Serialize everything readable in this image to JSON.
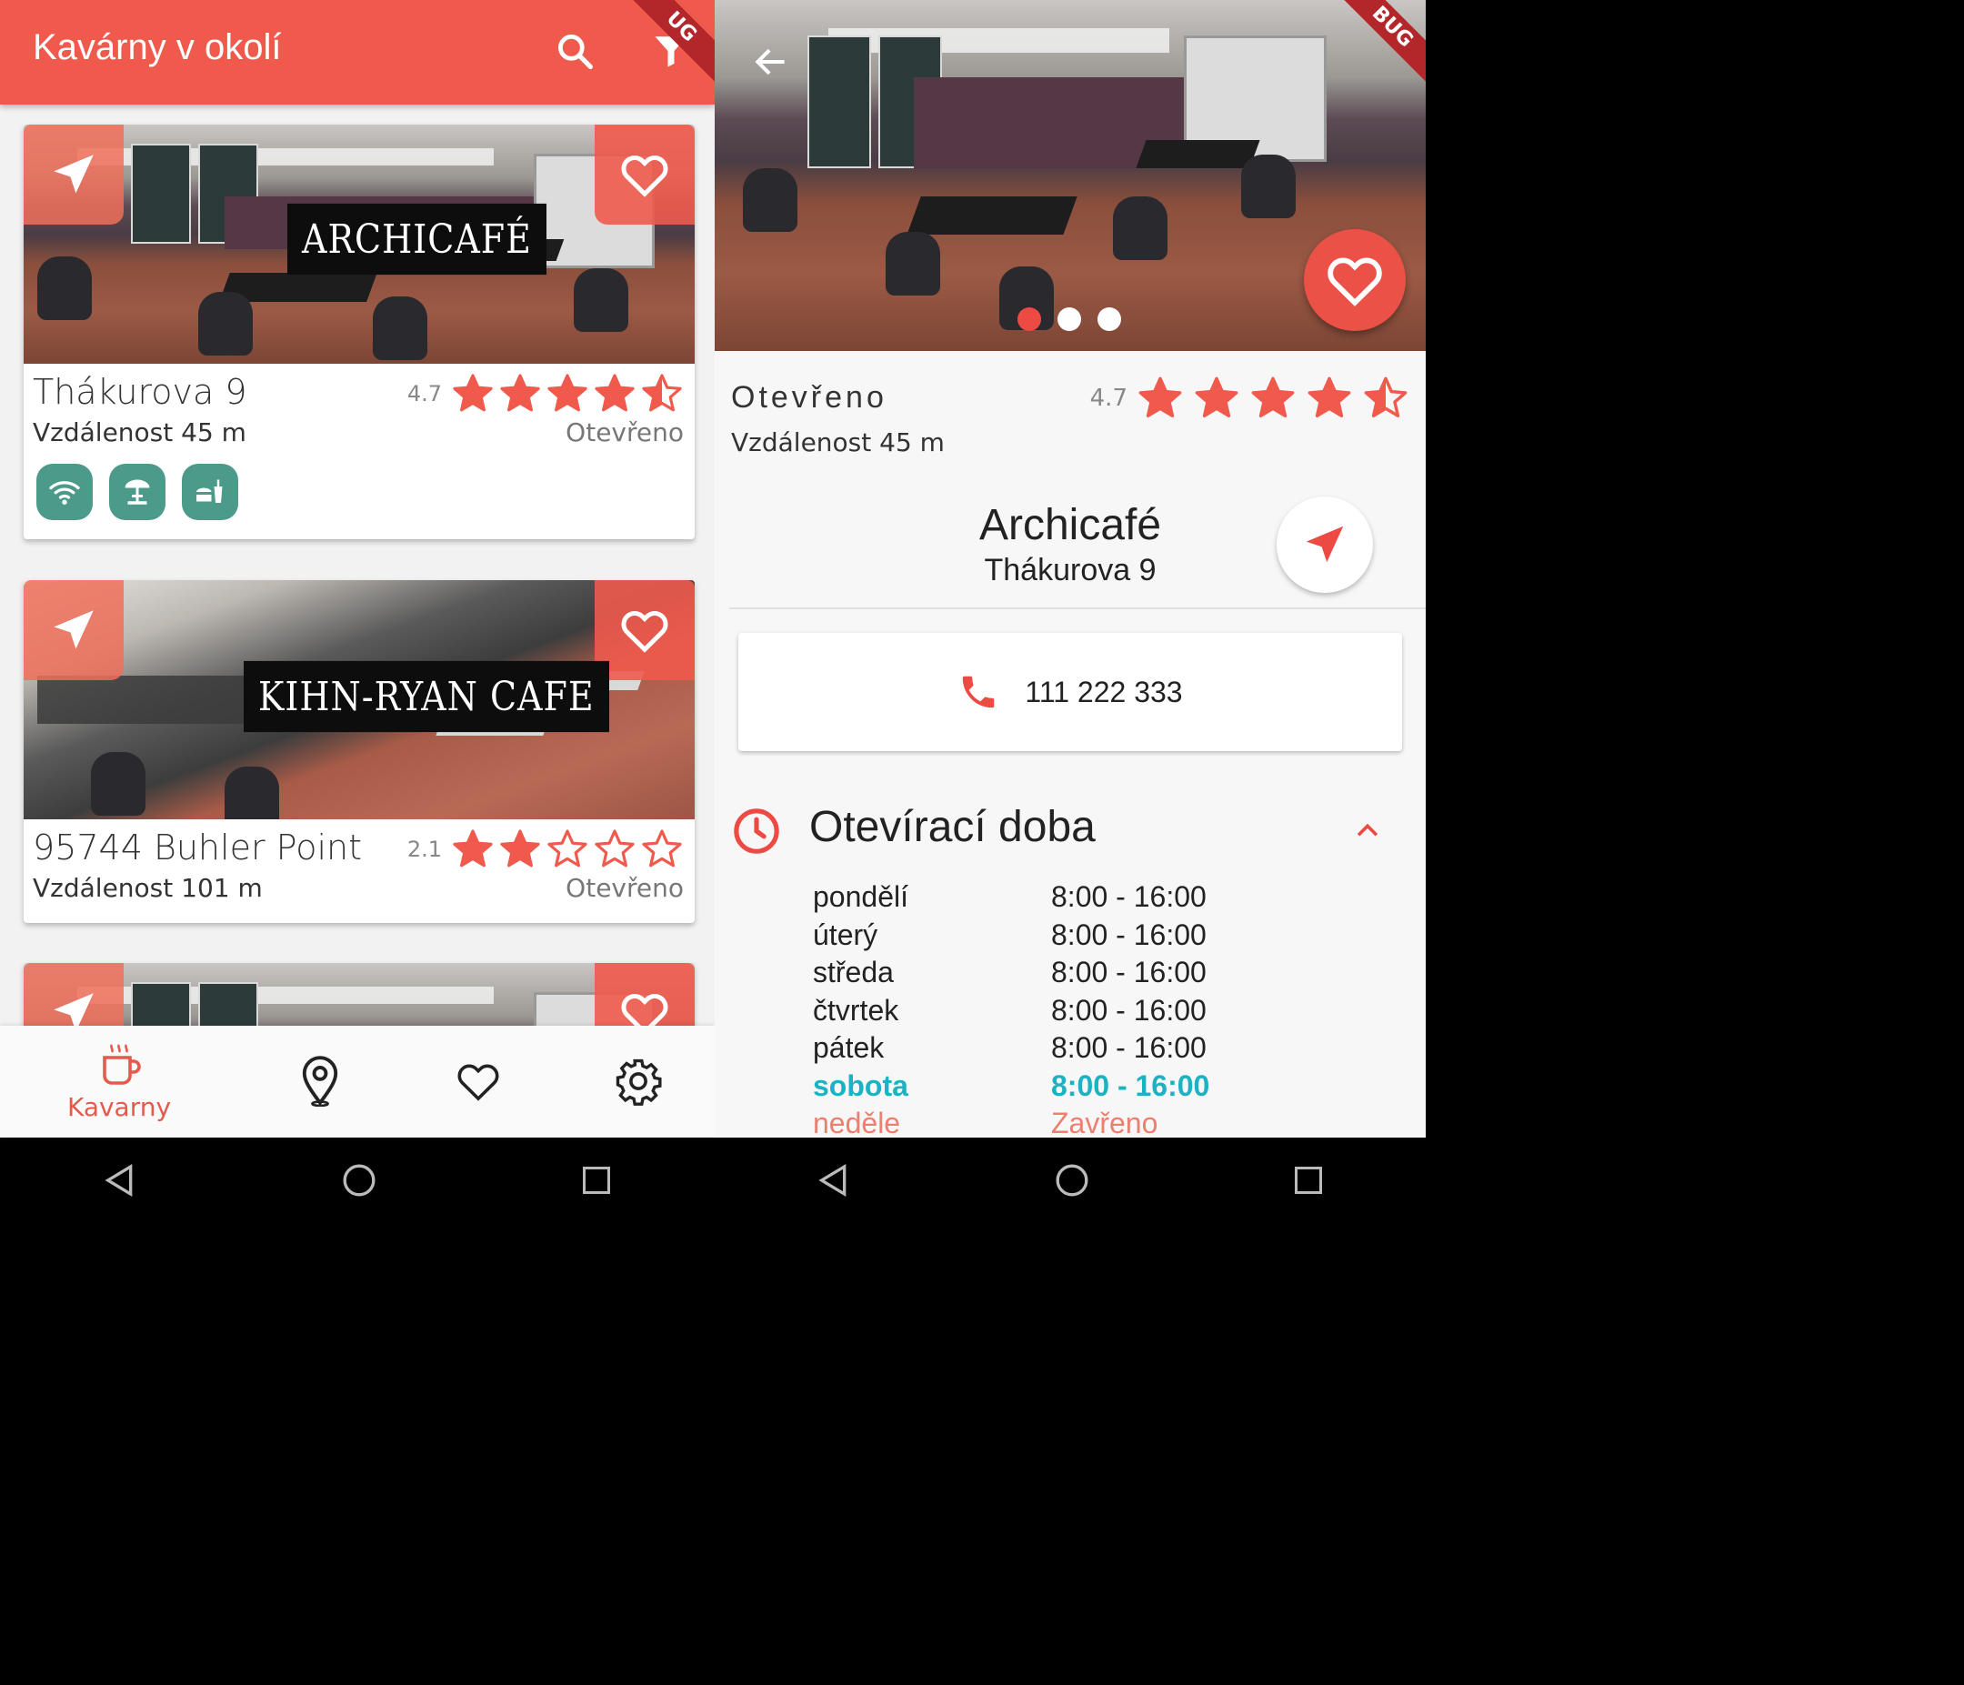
{
  "left": {
    "appbar": {
      "title": "Kavárny v okolí",
      "search_icon": "search-icon",
      "filter_icon": "filter-icon"
    },
    "debug_banner": "UG",
    "cards": [
      {
        "name_label": "ARCHICAFÉ",
        "address": "Thákurova 9",
        "distance": "Vzdálenost 45 m",
        "status": "Otevřeno",
        "rating": "4.7",
        "rating_value": 4.7,
        "features": [
          "wifi-icon",
          "terrace-icon",
          "food-drink-icon"
        ]
      },
      {
        "name_label": "KIHN-RYAN CAFE",
        "address": "95744 Buhler Point",
        "distance": "Vzdálenost 101 m",
        "status": "Otevřeno",
        "rating": "2.1",
        "rating_value": 2.1,
        "features": []
      }
    ],
    "bottom_nav": {
      "items": [
        {
          "label": "Kavarny",
          "icon": "coffee-cup-icon",
          "active": true
        },
        {
          "label": "",
          "icon": "map-pin-icon",
          "active": false
        },
        {
          "label": "",
          "icon": "heart-icon",
          "active": false
        },
        {
          "label": "",
          "icon": "settings-icon",
          "active": false
        }
      ]
    }
  },
  "right": {
    "debug_banner": "BUG",
    "gallery": {
      "count": 3,
      "active_index": 0
    },
    "status": "Otevřeno",
    "distance": "Vzdálenost 45 m",
    "rating": "4.7",
    "rating_value": 4.7,
    "name": "Archicafé",
    "address": "Thákurova 9",
    "phone": "111 222 333",
    "hours": {
      "title": "Otevírací doba",
      "days": [
        {
          "day": "pondělí",
          "time": "8:00 - 16:00",
          "state": "normal"
        },
        {
          "day": "úterý",
          "time": "8:00 - 16:00",
          "state": "normal"
        },
        {
          "day": "středa",
          "time": "8:00 - 16:00",
          "state": "normal"
        },
        {
          "day": "čtvrtek",
          "time": "8:00 - 16:00",
          "state": "normal"
        },
        {
          "day": "pátek",
          "time": "8:00 - 16:00",
          "state": "normal"
        },
        {
          "day": "sobota",
          "time": "8:00 - 16:00",
          "state": "today"
        },
        {
          "day": "neděle",
          "time": "Zavřeno",
          "state": "closed"
        }
      ]
    }
  },
  "colors": {
    "accent": "#f05a4d",
    "feature_teal": "#4b9a8a",
    "today": "#1bb2c4",
    "closed": "#ec7f70"
  }
}
